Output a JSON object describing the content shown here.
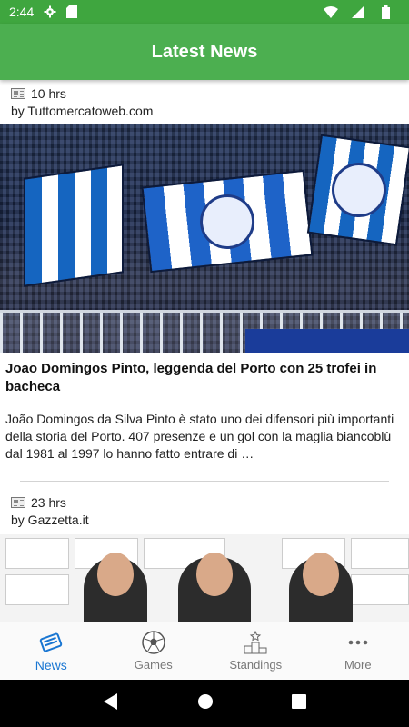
{
  "status_bar": {
    "time": "2:44",
    "icons": [
      "gear-icon",
      "sd-card-icon",
      "wifi-icon",
      "signal-icon",
      "battery-icon"
    ]
  },
  "app_bar": {
    "title": "Latest News",
    "color": "#4caf50"
  },
  "articles": [
    {
      "age": "10 hrs",
      "source": "by Tuttomercatoweb.com",
      "title": "Joao Domingos Pinto, leggenda del Porto con 25 trofei in bacheca",
      "description": "João Domingos da Silva Pinto è stato uno dei difensori più importanti della storia del Porto. 407 presenze e un gol con la maglia biancoblù dal 1981 al 1997 lo hanno fatto entrare di …"
    },
    {
      "age": "23 hrs",
      "source": "by Gazzetta.it"
    }
  ],
  "tabs": [
    {
      "label": "News",
      "icon": "newspaper-icon",
      "active": true
    },
    {
      "label": "Games",
      "icon": "soccer-ball-icon",
      "active": false
    },
    {
      "label": "Standings",
      "icon": "podium-icon",
      "active": false
    },
    {
      "label": "More",
      "icon": "more-dots-icon",
      "active": false
    }
  ],
  "accent_color": "#1976d2",
  "nav_bar": {
    "buttons": [
      "back-icon",
      "home-icon",
      "recents-icon"
    ]
  }
}
